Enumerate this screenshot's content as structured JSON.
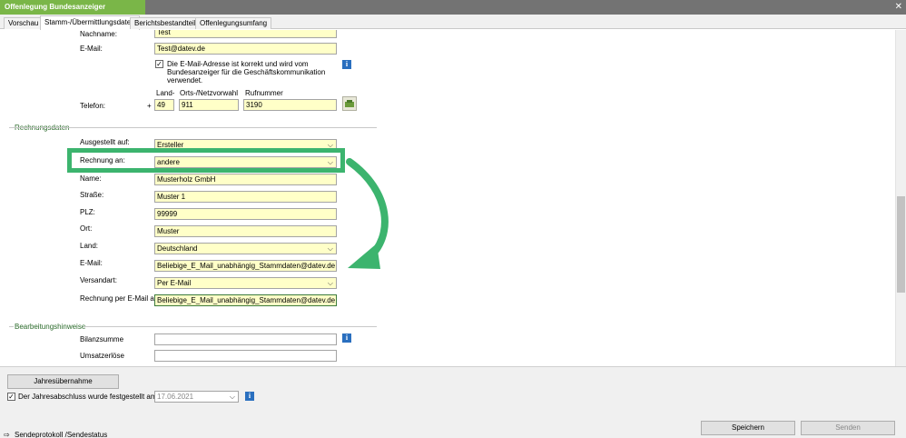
{
  "window": {
    "title": "Offenlegung Bundesanzeiger",
    "close": "✕"
  },
  "tabs": [
    "Vorschau",
    "Stamm-/Übermittlungsdaten",
    "Berichtsbestandteile",
    "Offenlegungsumfang"
  ],
  "contact": {
    "nachname_label": "Nachname:",
    "nachname_value": "Test",
    "email_label": "E-Mail:",
    "email_value": "Test@datev.de",
    "email_confirm": "Die E-Mail-Adresse ist korrekt und wird vom Bundesanzeiger für die Geschäftskommunikation verwendet.",
    "email_confirm_l1": "Die E-Mail-Adresse ist korrekt und wird vom",
    "email_confirm_l2": "Bundesanzeiger für die Geschäftskommunikation",
    "email_confirm_l3": "verwendet.",
    "phone_label": "Telefon:",
    "plus": "+",
    "land_header": "Land-",
    "vorwahl_header": "Orts-/Netzvorwahl",
    "rufnummer_header": "Rufnummer",
    "land_value": "49",
    "vorwahl_value": "911",
    "rufnummer_value": "3190"
  },
  "rechnung": {
    "section": "Rechnungsdaten",
    "ausgestellt_label": "Ausgestellt auf:",
    "ausgestellt_value": "Ersteller",
    "an_label": "Rechnung an:",
    "an_value": "andere",
    "name_label": "Name:",
    "name_value": "Musterholz GmbH",
    "strasse_label": "Straße:",
    "strasse_value": "Muster 1",
    "plz_label": "PLZ:",
    "plz_value": "99999",
    "ort_label": "Ort:",
    "ort_value": "Muster",
    "land_label": "Land:",
    "land_value": "Deutschland",
    "email_label": "E-Mail:",
    "email_value": "Beliebige_E_Mail_unabhängig_Stammdaten@datev.de",
    "versandart_label": "Versandart:",
    "versandart_value": "Per E-Mail",
    "rpe_label": "Rechnung per E-Mail an:",
    "rpe_value": "Beliebige_E_Mail_unabhängig_Stammdaten@datev.de"
  },
  "bearbeitung": {
    "section": "Bearbeitungshinweise",
    "bilanz_label": "Bilanzsumme",
    "umsatz_label": "Umsatzerlöse"
  },
  "footer": {
    "jahresuebernahme": "Jahresübernahme",
    "festgestellt_label": "Der Jahresabschluss wurde festgestellt am:",
    "festgestellt_date": "17.06.2021",
    "sendeprotokoll": "Sendeprotokoll /Sendestatus",
    "speichern": "Speichern",
    "senden": "Senden"
  },
  "icons": {
    "info": "i",
    "dropdown": "⌵",
    "check": "✓",
    "arrow": "⇨"
  },
  "colors": {
    "accent": "#7ab648",
    "highlight": "#3cb46e",
    "field_bg": "#ffffc8",
    "section": "#2a6a2a"
  }
}
